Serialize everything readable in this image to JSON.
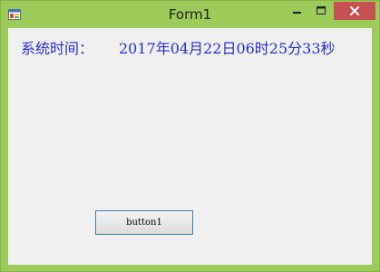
{
  "window": {
    "title": "Form1",
    "icon": "winforms-app-icon",
    "caption_buttons": [
      "minimize-icon",
      "maximize-icon",
      "close-icon"
    ],
    "frame_color": "#9ccb5a",
    "close_color": "#c75050"
  },
  "form": {
    "time_label": "系统时间：",
    "time_value": "2017年04月22日06时25分33秒",
    "text_color": "#2c2ad6",
    "button1_label": "button1"
  }
}
